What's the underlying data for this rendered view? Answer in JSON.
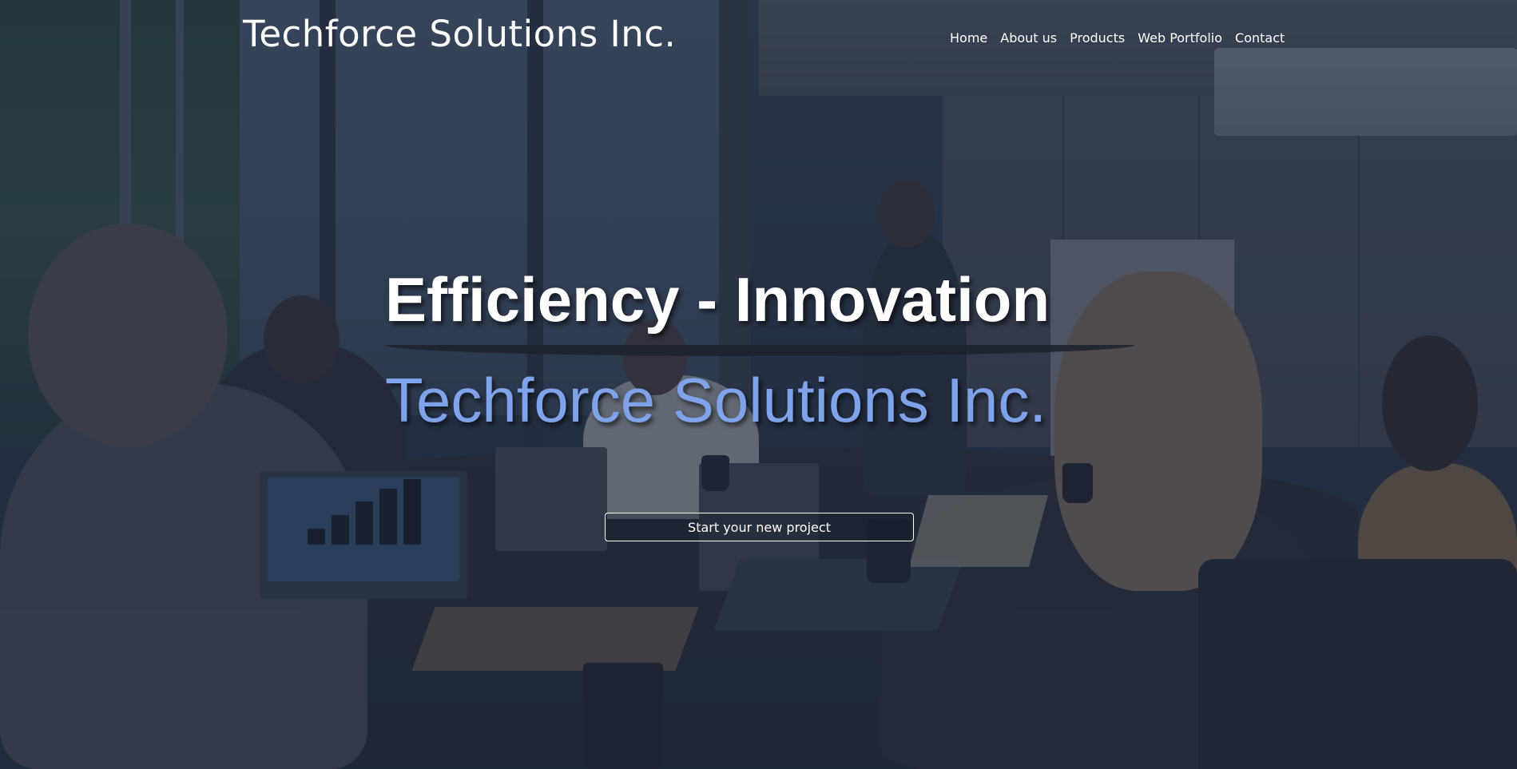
{
  "header": {
    "brand": "Techforce Solutions Inc.",
    "nav": [
      {
        "label": "Home"
      },
      {
        "label": "About us"
      },
      {
        "label": "Products"
      },
      {
        "label": "Web Portfolio"
      },
      {
        "label": "Contact"
      }
    ]
  },
  "hero": {
    "tagline": "Efficiency - Innovation",
    "company": "Techforce Solutions Inc.",
    "cta_label": "Start your new project",
    "background_image": "meeting-room-photo"
  },
  "colors": {
    "overlay": "#1e283e",
    "company_text": "#7ea3ea",
    "text": "#ffffff"
  }
}
